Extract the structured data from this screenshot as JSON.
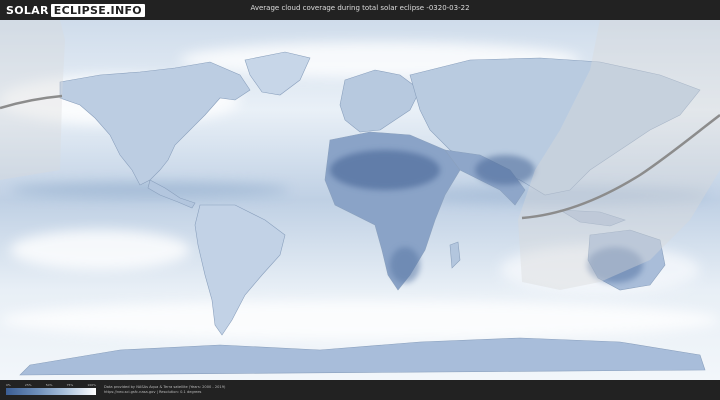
{
  "header": {
    "logo_part1": "SOLAR",
    "logo_part2": "ECLIPSE.INFO",
    "title": "Average cloud coverage during total solar eclipse -0320-03-22"
  },
  "map": {
    "ocean_color": "#e6eef6",
    "cloud_light": "#ffffff",
    "cloud_dark": "#5f7fae",
    "land_outline": "#8aa0bd",
    "path_color": "#8c8c8c",
    "shadow_zone": "#d9d9d9"
  },
  "legend": {
    "ticks": [
      "0%",
      "25%",
      "50%",
      "75%",
      "100%"
    ]
  },
  "footer": {
    "credit_line1": "Data provided by NASAs Aqua & Terra satellite (Years: 2000 - 2019)",
    "credit_line2": "https://neo.sci.gsfc.nasa.gov | Resolution: 0.1 degrees"
  }
}
